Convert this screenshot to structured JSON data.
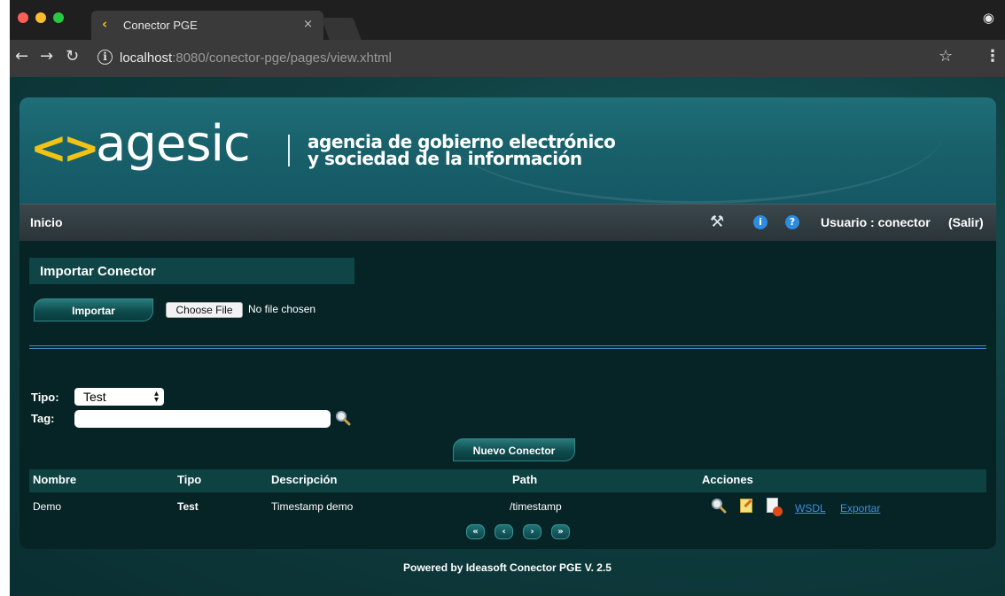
{
  "browser": {
    "tab_title": "Conector PGE",
    "tab_close": "×",
    "url_host": "localhost",
    "url_rest": ":8080/conector-pge/pages/view.xhtml",
    "icons": {
      "back": "back-arrow-icon",
      "forward": "forward-arrow-icon",
      "reload": "reload-icon",
      "site_info": "info-icon",
      "bookmark": "star-icon",
      "menu": "kebab-menu-icon",
      "incognito": "incognito-icon"
    }
  },
  "header": {
    "logo_mark": "<>",
    "logo_word": "agesic",
    "tagline_1": "agencia de gobierno electrónico",
    "tagline_2": "y sociedad de la información",
    "colors": {
      "brand_yellow": "#f2c315",
      "header_teal": "#1f6e78"
    }
  },
  "menubar": {
    "home": "Inicio",
    "user_label": "Usuario : conector",
    "logout": "(Salir)"
  },
  "import_section": {
    "title": "Importar Conector",
    "import_button": "Importar",
    "choose_file": "Choose File",
    "no_file": "No file chosen"
  },
  "filters": {
    "tipo_label": "Tipo:",
    "tipo_value": "Test",
    "tag_label": "Tag:",
    "tag_value": ""
  },
  "new_button": "Nuevo Conector",
  "table": {
    "headers": [
      "Nombre",
      "Tipo",
      "Descripción",
      "Path",
      "Acciones"
    ],
    "rows": [
      {
        "nombre": "Demo",
        "tipo": "Test",
        "descripcion": "Timestamp demo",
        "path": "/timestamp",
        "links": [
          "WSDL",
          "Exportar"
        ]
      }
    ]
  },
  "pagination": {
    "first": "«",
    "prev": "‹",
    "next": "›",
    "last": "»"
  },
  "footer": "Powered by Ideasoft Conector PGE V. 2.5"
}
